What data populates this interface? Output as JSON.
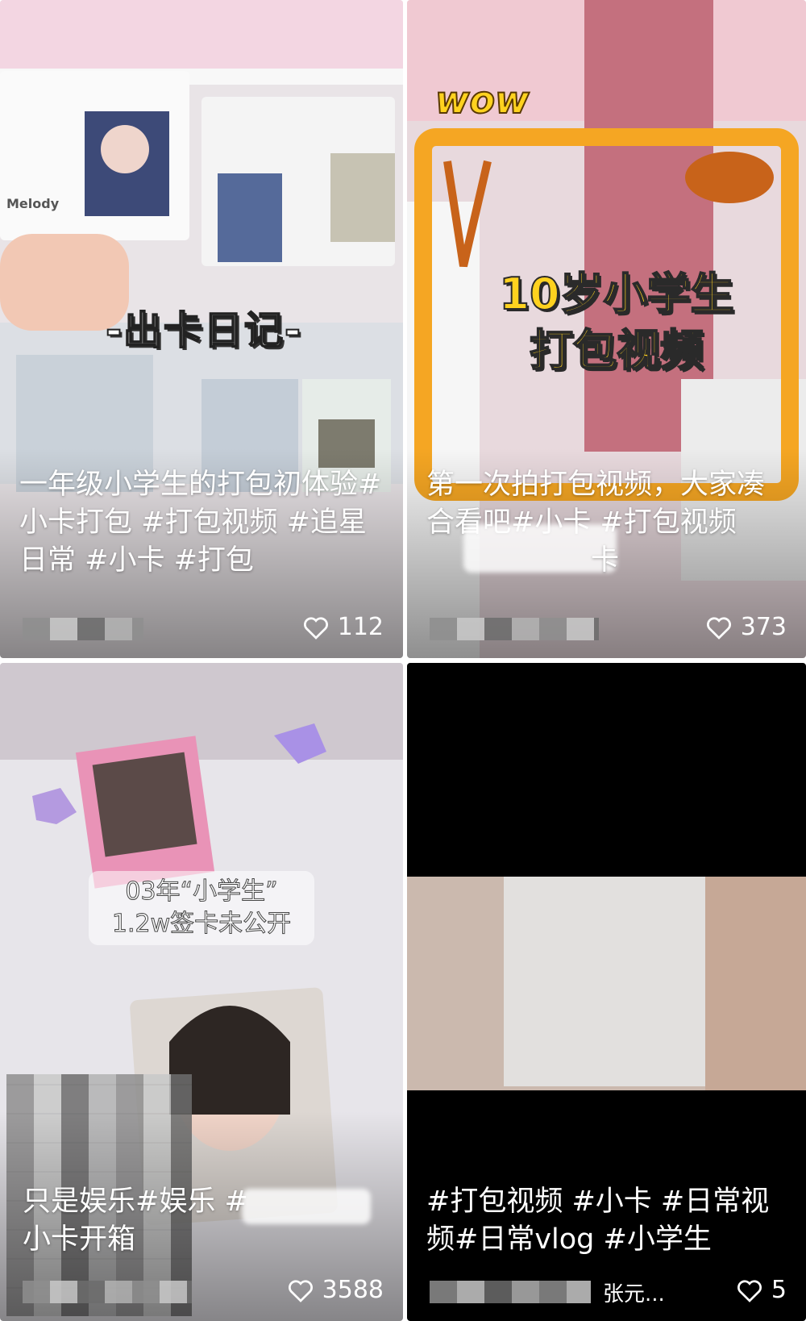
{
  "feed": {
    "cards": [
      {
        "overlay_title": "-出卡日记-",
        "sticker_text": "Melody",
        "caption": "一年级小学生的打包初体验#小卡打包 #打包视频 #追星日常 #小卡 #打包",
        "likes": "112"
      },
      {
        "sticker_text": "wow",
        "overlay_title_line1": "10岁小学生",
        "overlay_title_line2": "打包视频",
        "caption": "第一次拍打包视频，大家凑合看吧#小卡 #打包视频",
        "caption_tail": "卡",
        "likes": "373"
      },
      {
        "overlay_title_line1": "03年“小学生”",
        "overlay_title_line2": "1.2w签卡未公开",
        "caption": "只是娱乐#娱乐 #",
        "caption_line2": "小卡开箱",
        "likes": "3588"
      },
      {
        "caption": "#打包视频 #小卡 #日常视频#日常vlog #小学生",
        "author": "张元...",
        "likes": "5"
      }
    ]
  },
  "icons": {
    "like": "heart-outline-icon"
  },
  "colors": {
    "overlay_yellow": "#ffd21f",
    "caption_text": "#ffffff",
    "frame_orange": "#f5a623"
  }
}
